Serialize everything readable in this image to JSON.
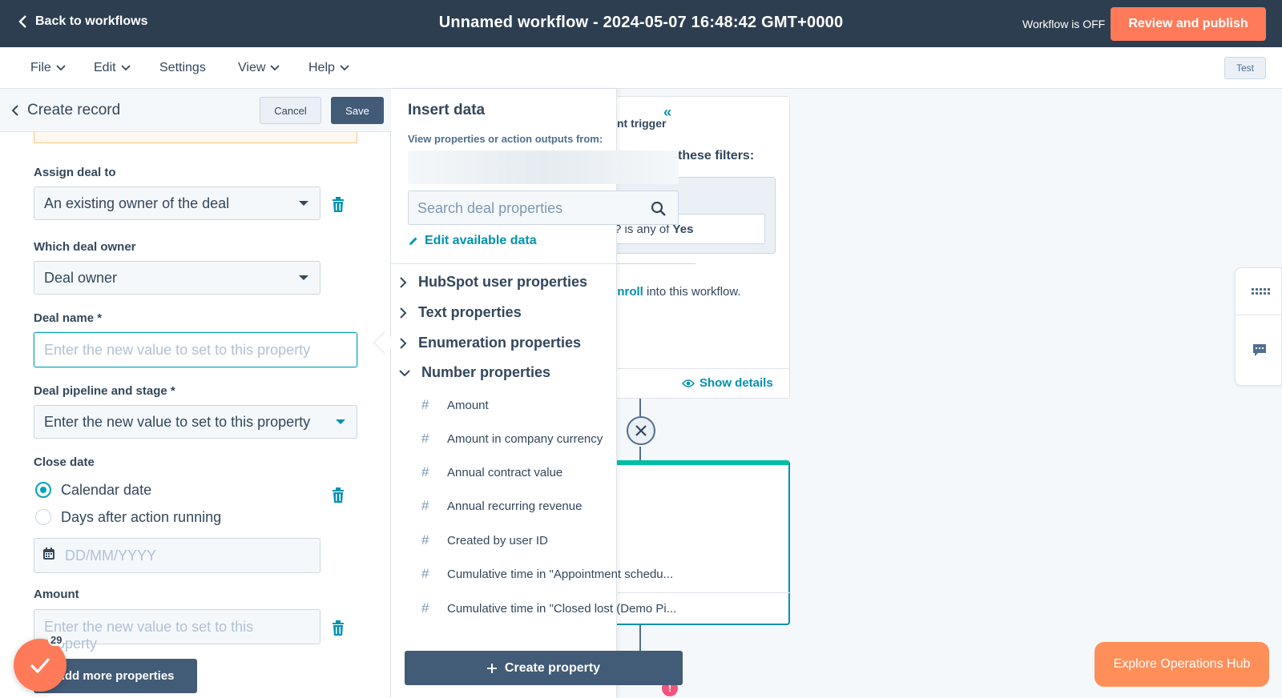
{
  "topbar": {
    "back_label": "Back to workflows",
    "title": "Unnamed workflow - 2024-05-07 16:48:42 GMT+0000",
    "status": "Workflow is OFF",
    "publish_label": "Review and publish"
  },
  "menu": {
    "items": [
      "File",
      "Edit",
      "Settings",
      "View",
      "Help"
    ],
    "test_label": "Test"
  },
  "left_panel": {
    "title": "Create record",
    "cancel_label": "Cancel",
    "save_label": "Save",
    "assign_label": "Assign deal to",
    "assign_value": "An existing owner of the deal",
    "which_owner_label": "Which deal owner",
    "which_owner_value": "Deal owner",
    "deal_name_label": "Deal name *",
    "deal_name_placeholder": "Enter the new value to set to this property",
    "pipeline_label": "Deal pipeline and stage *",
    "pipeline_value": "Enter the new value to set to this property",
    "close_date_label": "Close date",
    "radio_calendar": "Calendar date",
    "radio_days": "Days after action running",
    "date_placeholder": "DD/MM/YYYY",
    "amount_label": "Amount",
    "amount_placeholder": "Enter the new value to set to this property",
    "add_more_label": "Add more properties",
    "badge_count": "29"
  },
  "insert_data": {
    "title": "Insert data",
    "subtitle": "View properties or action outputs from:",
    "search_placeholder": "Search deal properties",
    "edit_label": "Edit available data",
    "groups": [
      "HubSpot user properties",
      "Text properties",
      "Enumeration properties",
      "Number properties"
    ],
    "number_properties": [
      "Amount",
      "Amount in company currency",
      "Annual contract value",
      "Annual recurring revenue",
      "Created by user ID",
      "Cumulative time in \"Appointment schedu...",
      "Cumulative time in \"Closed lost (Demo Pi..."
    ],
    "create_label": "Create property"
  },
  "canvas": {
    "trigger_title": "nt trigger",
    "filters_text": "these filters:",
    "filter_text": "? is any of",
    "filter_value": "Yes",
    "enroll_link": "enroll",
    "enroll_rest": " into this workflow.",
    "show_details": "Show details",
    "explore_label": "Explore Operations Hub"
  },
  "colors": {
    "topbar": "#2d3e50",
    "accent": "#ff7a59",
    "link": "#0091ae",
    "dark_button": "#425b76"
  }
}
